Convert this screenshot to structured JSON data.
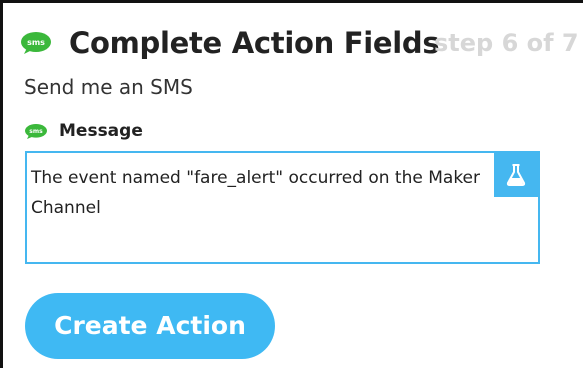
{
  "header": {
    "icon": "sms-icon",
    "icon_text": "sms",
    "title": "Complete Action Fields",
    "step": "step 6 of 7"
  },
  "subtitle": "Send me an SMS",
  "field": {
    "icon": "sms-icon",
    "icon_text": "sms",
    "label": "Message",
    "value": "The event named \"fare_alert\" occurred on the Maker Channel",
    "ingredient_icon": "flask-icon"
  },
  "action_button": {
    "label": "Create Action"
  },
  "colors": {
    "sms_green": "#3bb83b",
    "accent_blue": "#45b7f0",
    "button_blue": "#3fb9f3",
    "step_gray": "#d7d7d7"
  }
}
